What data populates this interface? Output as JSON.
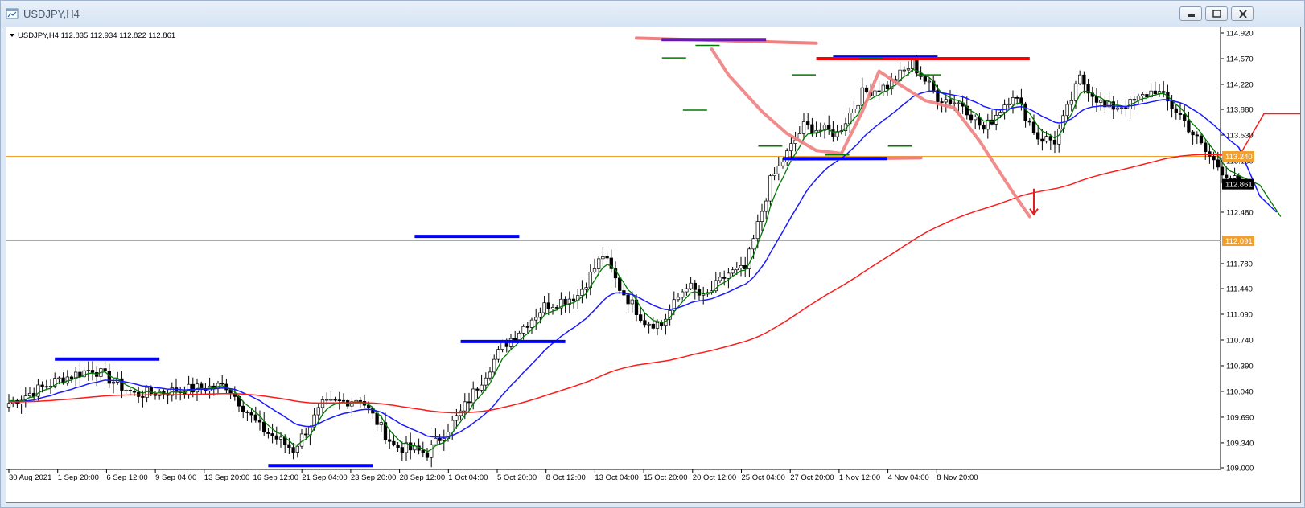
{
  "window": {
    "title": "USDJPY,H4",
    "buttons": {
      "minimize": "minimize",
      "restore": "restore",
      "close": "close"
    }
  },
  "chart_data": {
    "type": "line",
    "symbol_header": "USDJPY,H4  112.835 112.934 112.822 112.861",
    "ylim": [
      109.0,
      114.92
    ],
    "y_ticks": [
      "114.920",
      "114.570",
      "114.220",
      "113.880",
      "113.530",
      "113.180",
      "112.480",
      "111.780",
      "111.440",
      "111.090",
      "110.740",
      "110.390",
      "110.040",
      "109.690",
      "109.340",
      "109.000"
    ],
    "x_tick_labels": [
      "30 Aug 2021",
      "1 Sep 20:00",
      "6 Sep 12:00",
      "9 Sep 04:00",
      "13 Sep 20:00",
      "16 Sep 12:00",
      "21 Sep 04:00",
      "23 Sep 20:00",
      "28 Sep 12:00",
      "1 Oct 04:00",
      "5 Oct 20:00",
      "8 Oct 12:00",
      "13 Oct 04:00",
      "15 Oct 20:00",
      "20 Oct 12:00",
      "25 Oct 04:00",
      "27 Oct 20:00",
      "1 Nov 12:00",
      "4 Nov 04:00",
      "8 Nov 20:00"
    ],
    "price_labels": [
      {
        "value": 113.24,
        "text": "113.240",
        "color": "#f0a030"
      },
      {
        "value": 112.861,
        "text": "112.861",
        "color": "#000000"
      },
      {
        "value": 112.091,
        "text": "112.091",
        "color": "#f0a030"
      }
    ],
    "horizontal_lines": [
      {
        "value": 113.24,
        "color": "#f0a030"
      },
      {
        "value": 112.091,
        "color": "#f0a030"
      }
    ],
    "close_anchors": [
      [
        0,
        109.88
      ],
      [
        12,
        110.2
      ],
      [
        20,
        110.35
      ],
      [
        30,
        110.0
      ],
      [
        40,
        110.05
      ],
      [
        52,
        110.12
      ],
      [
        60,
        109.55
      ],
      [
        68,
        109.25
      ],
      [
        75,
        109.85
      ],
      [
        84,
        109.95
      ],
      [
        92,
        109.3
      ],
      [
        100,
        109.2
      ],
      [
        108,
        109.75
      ],
      [
        118,
        110.65
      ],
      [
        128,
        111.2
      ],
      [
        136,
        111.35
      ],
      [
        142,
        111.9
      ],
      [
        146,
        111.45
      ],
      [
        152,
        111.0
      ],
      [
        156,
        110.95
      ],
      [
        162,
        111.5
      ],
      [
        166,
        111.3
      ],
      [
        172,
        111.65
      ],
      [
        176,
        111.7
      ],
      [
        182,
        112.9
      ],
      [
        190,
        113.65
      ],
      [
        198,
        113.55
      ],
      [
        204,
        114.1
      ],
      [
        210,
        114.2
      ],
      [
        216,
        114.5
      ],
      [
        222,
        114.05
      ],
      [
        228,
        113.95
      ],
      [
        233,
        113.6
      ],
      [
        240,
        114.1
      ],
      [
        246,
        113.5
      ],
      [
        250,
        113.45
      ],
      [
        256,
        114.3
      ],
      [
        262,
        113.9
      ],
      [
        268,
        113.95
      ],
      [
        274,
        114.15
      ],
      [
        280,
        113.8
      ],
      [
        286,
        113.3
      ],
      [
        290,
        113.05
      ],
      [
        294,
        112.861
      ]
    ],
    "series": [
      {
        "name": "MA fast",
        "color": "#007a00"
      },
      {
        "name": "MA medium",
        "color": "#1a1aff"
      },
      {
        "name": "MA slow",
        "color": "#ff1a1a"
      }
    ],
    "annotations": {
      "blue_levels": [
        {
          "x0": 11,
          "x1": 36,
          "y": 110.48
        },
        {
          "x0": 62,
          "x1": 87,
          "y": 109.03
        },
        {
          "x0": 97,
          "x1": 122,
          "y": 112.15
        },
        {
          "x0": 108,
          "x1": 133,
          "y": 110.72
        },
        {
          "x0": 156,
          "x1": 181,
          "y": 114.83
        },
        {
          "x0": 185,
          "x1": 210,
          "y": 113.21
        },
        {
          "x0": 197,
          "x1": 222,
          "y": 114.59
        }
      ],
      "red_level": {
        "x0": 193,
        "x1": 244,
        "y": 114.57
      },
      "pink_levels": [
        {
          "x0": 150,
          "x1": 193,
          "y0": 114.85,
          "y1": 114.78
        },
        {
          "x0": 187,
          "x1": 218,
          "y0": 113.2,
          "y1": 113.22
        }
      ],
      "pink_trend_lines": [
        [
          [
            168,
            114.7
          ],
          [
            172,
            114.35
          ],
          [
            180,
            113.85
          ],
          [
            186,
            113.55
          ],
          [
            193,
            113.32
          ],
          [
            199,
            113.28
          ],
          [
            204,
            113.85
          ],
          [
            208,
            114.4
          ],
          [
            212,
            114.25
          ],
          [
            219,
            114.0
          ],
          [
            226,
            113.9
          ],
          [
            232,
            113.45
          ],
          [
            240,
            112.75
          ],
          [
            244,
            112.42
          ]
        ]
      ],
      "green_ticks": [
        [
          159,
          114.58
        ],
        [
          167,
          114.75
        ],
        [
          164,
          113.87
        ],
        [
          182,
          113.38
        ],
        [
          190,
          114.35
        ],
        [
          198,
          113.26
        ],
        [
          206,
          114.58
        ],
        [
          213,
          113.38
        ],
        [
          220,
          114.35
        ]
      ],
      "down_arrow": {
        "x": 245,
        "y0": 112.8,
        "y1": 112.45
      }
    }
  }
}
